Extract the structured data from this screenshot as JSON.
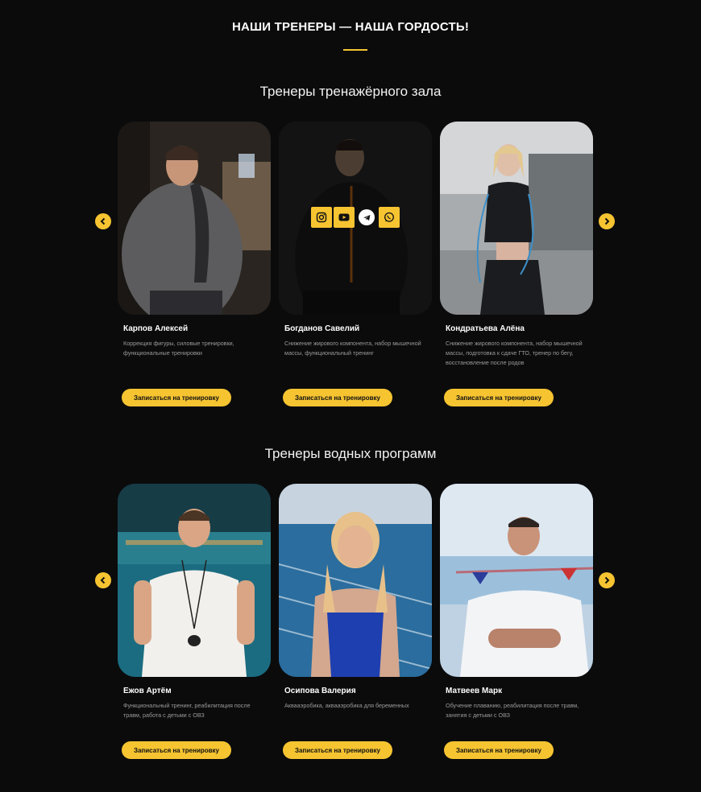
{
  "header": {
    "title": "НАШИ ТРЕНЕРЫ — НАША ГОРДОСТЬ!"
  },
  "colors": {
    "accent": "#f6c431",
    "background": "#0b0b0c"
  },
  "gym": {
    "title": "Тренеры тренажёрного зала",
    "trainers": [
      {
        "name": "Карпов Алексей",
        "description": "Коррекция фигуры, силовые тренировки, функциональные тренировки",
        "button": "Записаться на тренировку"
      },
      {
        "name": "Богданов Савелий",
        "description": "Снижение жирового компонента, набор мышечной массы, функциональный тренинг",
        "button": "Записаться на тренировку"
      },
      {
        "name": "Кондратьева Алёна",
        "description": "Снижение жирового компонента, набор мышечной массы, подготовка к сдаче ГТО, тренер по бегу, восстановление после родов",
        "button": "Записаться на тренировку"
      }
    ]
  },
  "water": {
    "title": "Тренеры водных программ",
    "trainers": [
      {
        "name": "Ежов Артём",
        "description": "Функциональный тренинг, реабилитация после травм, работа с детьми с ОВЗ",
        "button": "Записаться на тренировку"
      },
      {
        "name": "Осипова Валерия",
        "description": "Аквааэробика, аквааэробика для беременных",
        "button": "Записаться на тренировку"
      },
      {
        "name": "Матвеев Марк",
        "description": "Обучение плаванию, реабилитация после травм, занятия с детьми с ОВЗ",
        "button": "Записаться на тренировку"
      }
    ]
  },
  "icons": {
    "prev": "chevron-left-icon",
    "next": "chevron-right-icon",
    "socials": [
      "instagram-icon",
      "youtube-icon",
      "telegram-icon",
      "whatsapp-icon"
    ]
  }
}
